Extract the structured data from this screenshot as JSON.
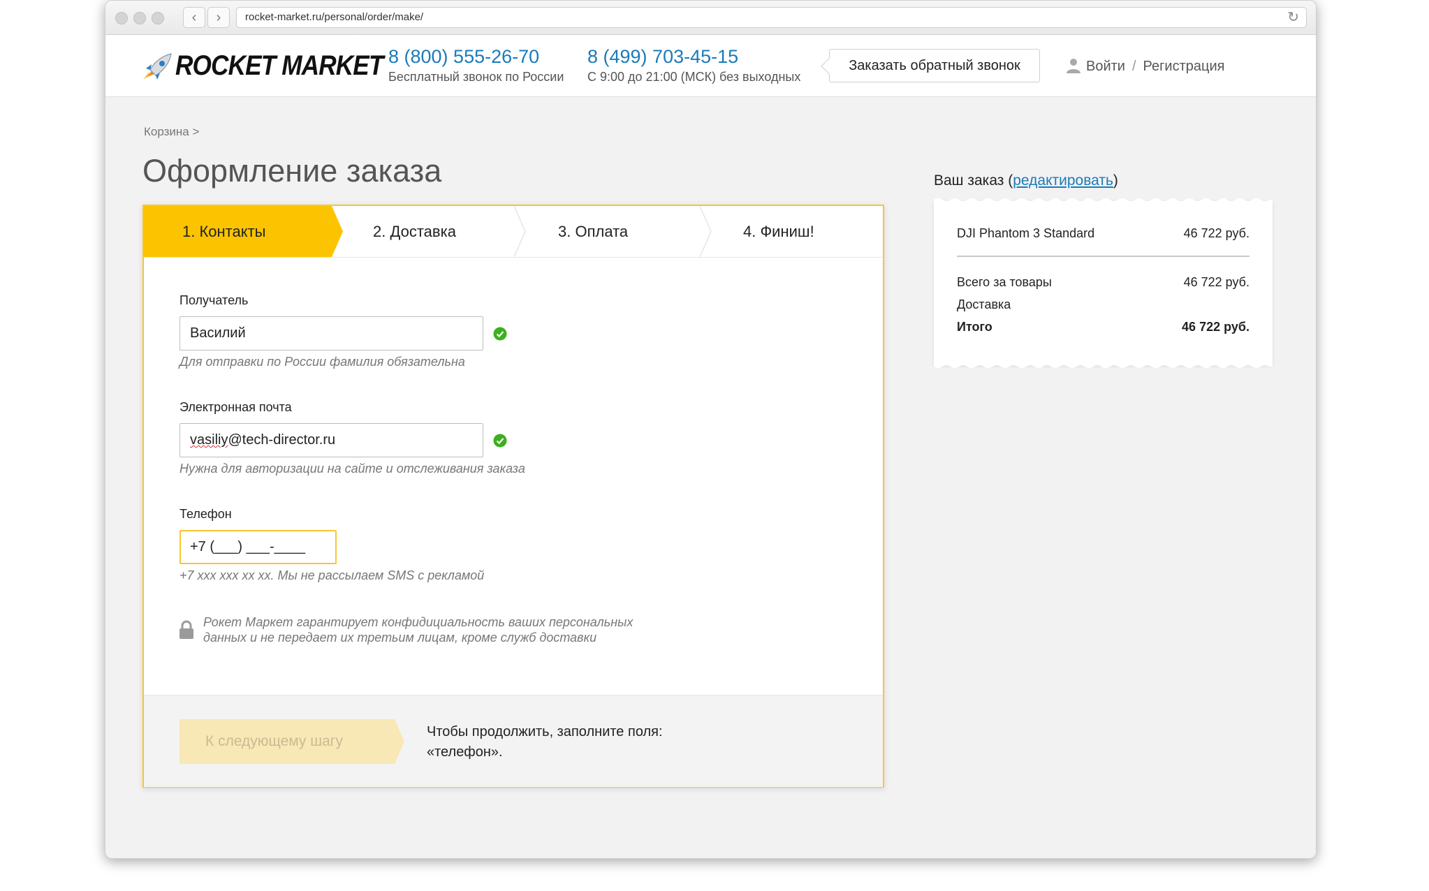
{
  "browser": {
    "url": "rocket-market.ru/personal/order/make/"
  },
  "header": {
    "logo_text": "ROCKET MARKET",
    "phone1": "8 (800) 555-26-70",
    "phone1_note": "Бесплатный звонок по России",
    "phone2": "8 (499) 703-45-15",
    "phone2_note": "С 9:00 до 21:00 (МСК) без выходных",
    "callback_label": "Заказать обратный звонок",
    "login_label": "Войти",
    "login_sep": "/",
    "register_label": "Регистрация"
  },
  "breadcrumb": "Корзина >",
  "page_title": "Оформление заказа",
  "steps": [
    "1. Контакты",
    "2. Доставка",
    "3. Оплата",
    "4. Финиш!"
  ],
  "form": {
    "recipient_label": "Получатель",
    "recipient_value": "Василий",
    "recipient_hint": "Для отправки по России фамилия обязательна",
    "email_label": "Электронная почта",
    "email_value_user": "vasiliy",
    "email_value_domain": "@tech-director.ru",
    "email_hint": "Нужна для авторизации на сайте и отслеживания заказа",
    "phone_label": "Телефон",
    "phone_value": "+7 (___) ___-____",
    "phone_hint": "+7 xxx xxx xx xx. Мы не рассылаем SMS с рекламой",
    "privacy_line1": "Рокет Маркет гарантирует конфидициальность ваших персональных",
    "privacy_line2": "данных и не передает их третьим лицам, кроме служб доставки",
    "next_button": "К следующему шагу",
    "continue_line1": "Чтобы продолжить, заполните поля:",
    "continue_line2": "«телефон»."
  },
  "summary": {
    "title": "Ваш заказ",
    "edit_open": "(",
    "edit_link": "редактировать",
    "edit_close": ")",
    "item_name": "DJI Phantom 3 Standard",
    "item_price": "46 722 руб.",
    "goods_label": "Всего за товары",
    "goods_value": "46 722 руб.",
    "delivery_label": "Доставка",
    "total_label": "Итого",
    "total_value": "46 722 руб."
  },
  "colors": {
    "accent": "#fcc400",
    "link": "#1a7bb9",
    "valid": "#3cb01f"
  }
}
